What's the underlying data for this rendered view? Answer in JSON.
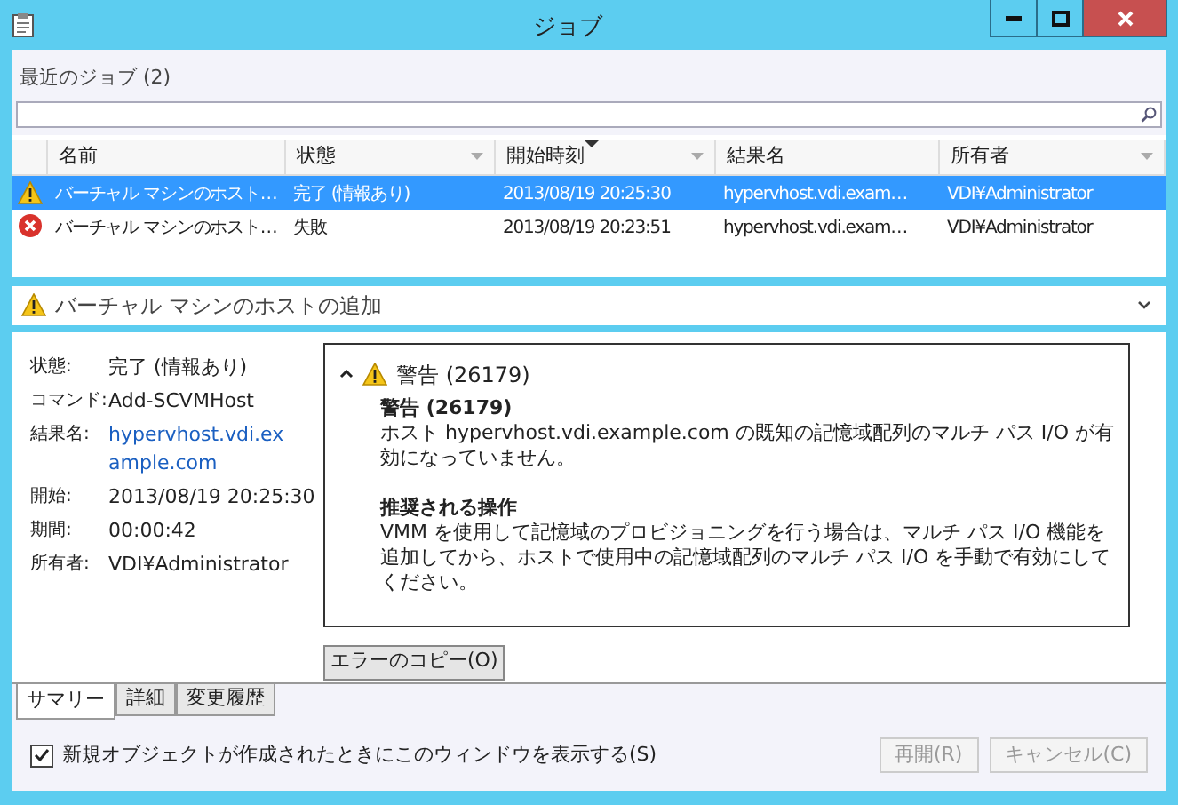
{
  "window": {
    "title": "ジョブ"
  },
  "recent_jobs": {
    "title": "最近のジョブ (2)"
  },
  "table": {
    "columns": [
      {
        "label": "名前",
        "sorted": false,
        "filter": false
      },
      {
        "label": "状態",
        "sorted": false,
        "filter": true
      },
      {
        "label": "開始時刻",
        "sorted": true,
        "filter": true
      },
      {
        "label": "結果名",
        "sorted": false,
        "filter": false
      },
      {
        "label": "所有者",
        "sorted": false,
        "filter": true
      }
    ],
    "rows": [
      {
        "kind": "warning",
        "selected": true,
        "cells": [
          "バーチャル マシンのホスト…",
          "完了 (情報あり)",
          "2013/08/19 20:25:30",
          "hypervhost.vdi.exam…",
          "VDI¥Administrator"
        ]
      },
      {
        "kind": "error",
        "selected": false,
        "cells": [
          "バーチャル マシンのホスト…",
          "失敗",
          "2013/08/19 20:23:51",
          "hypervhost.vdi.exam…",
          "VDI¥Administrator"
        ]
      }
    ]
  },
  "details": {
    "title": "バーチャル マシンのホストの追加",
    "kind": "warning",
    "expanded": true,
    "properties": [
      {
        "label": "状態:",
        "value": "完了 (情報あり)",
        "kind": "text"
      },
      {
        "label": "コマンド:",
        "value": "Add-SCVMHost",
        "kind": "text"
      },
      {
        "label": "結果名:",
        "value": "hypervhost.vdi.example.com",
        "kind": "link"
      },
      {
        "label": "開始:",
        "value": "2013/08/19 20:25:30",
        "kind": "text"
      },
      {
        "label": "期間:",
        "value": "00:00:42",
        "kind": "text"
      },
      {
        "label": "所有者:",
        "value": "VDI¥Administrator",
        "kind": "text"
      }
    ],
    "message": {
      "heading": "警告 (26179)",
      "expanded": true,
      "title": "警告 (26179)",
      "text": "ホスト hypervhost.vdi.example.com の既知の記憶域配列のマルチ パス I/O が有効になっていません。",
      "recommended_title": "推奨される操作",
      "recommended_text": "VMM を使用して記憶域のプロビジョニングを行う場合は、マルチ パス I/O 機能を追加してから、ホストで使用中の記憶域配列のマルチ パス I/O を手動で有効にしてください。"
    },
    "copy_button": "エラーのコピー(O)"
  },
  "tabs": [
    {
      "label": "サマリー",
      "selected": true
    },
    {
      "label": "詳細",
      "selected": false
    },
    {
      "label": "変更履歴",
      "selected": false
    }
  ],
  "footer": {
    "checkbox": {
      "label": "新規オブジェクトが作成されたときにこのウィンドウを表示する(S)",
      "checked": true
    },
    "buttons": [
      {
        "label": "再開(R)",
        "disabled": true
      },
      {
        "label": "キャンセル(C)",
        "disabled": true
      }
    ]
  }
}
